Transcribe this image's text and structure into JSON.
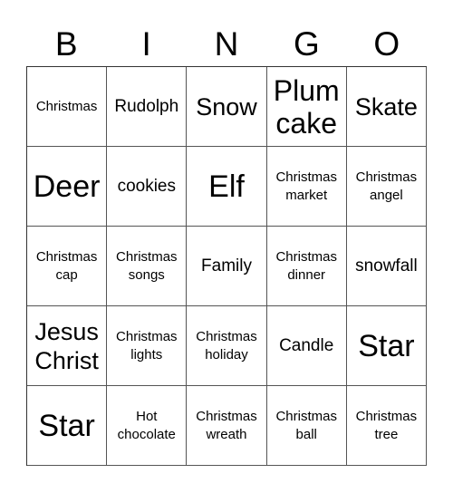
{
  "header": {
    "letters": [
      "B",
      "I",
      "N",
      "G",
      "O"
    ]
  },
  "board": {
    "rows": [
      [
        {
          "text": "Christmas",
          "size": "sm"
        },
        {
          "text": "Rudolph",
          "size": "md"
        },
        {
          "text": "Snow",
          "size": "lg"
        },
        {
          "text": "Plum cake",
          "size": "xl"
        },
        {
          "text": "Skate",
          "size": "lg"
        }
      ],
      [
        {
          "text": "Deer",
          "size": "xxl"
        },
        {
          "text": "cookies",
          "size": "md"
        },
        {
          "text": "Elf",
          "size": "xxl"
        },
        {
          "text": "Christmas market",
          "size": "sm"
        },
        {
          "text": "Christmas angel",
          "size": "sm"
        }
      ],
      [
        {
          "text": "Christmas cap",
          "size": "sm"
        },
        {
          "text": "Christmas songs",
          "size": "sm"
        },
        {
          "text": "Family",
          "size": "md"
        },
        {
          "text": "Christmas dinner",
          "size": "sm"
        },
        {
          "text": "snowfall",
          "size": "md"
        }
      ],
      [
        {
          "text": "Jesus Christ",
          "size": "lg"
        },
        {
          "text": "Christmas lights",
          "size": "sm"
        },
        {
          "text": "Christmas holiday",
          "size": "sm"
        },
        {
          "text": "Candle",
          "size": "md"
        },
        {
          "text": "Star",
          "size": "xxl"
        }
      ],
      [
        {
          "text": "Star",
          "size": "xxl"
        },
        {
          "text": "Hot chocolate",
          "size": "sm"
        },
        {
          "text": "Christmas wreath",
          "size": "sm"
        },
        {
          "text": "Christmas ball",
          "size": "sm"
        },
        {
          "text": "Christmas tree",
          "size": "sm"
        }
      ]
    ]
  }
}
